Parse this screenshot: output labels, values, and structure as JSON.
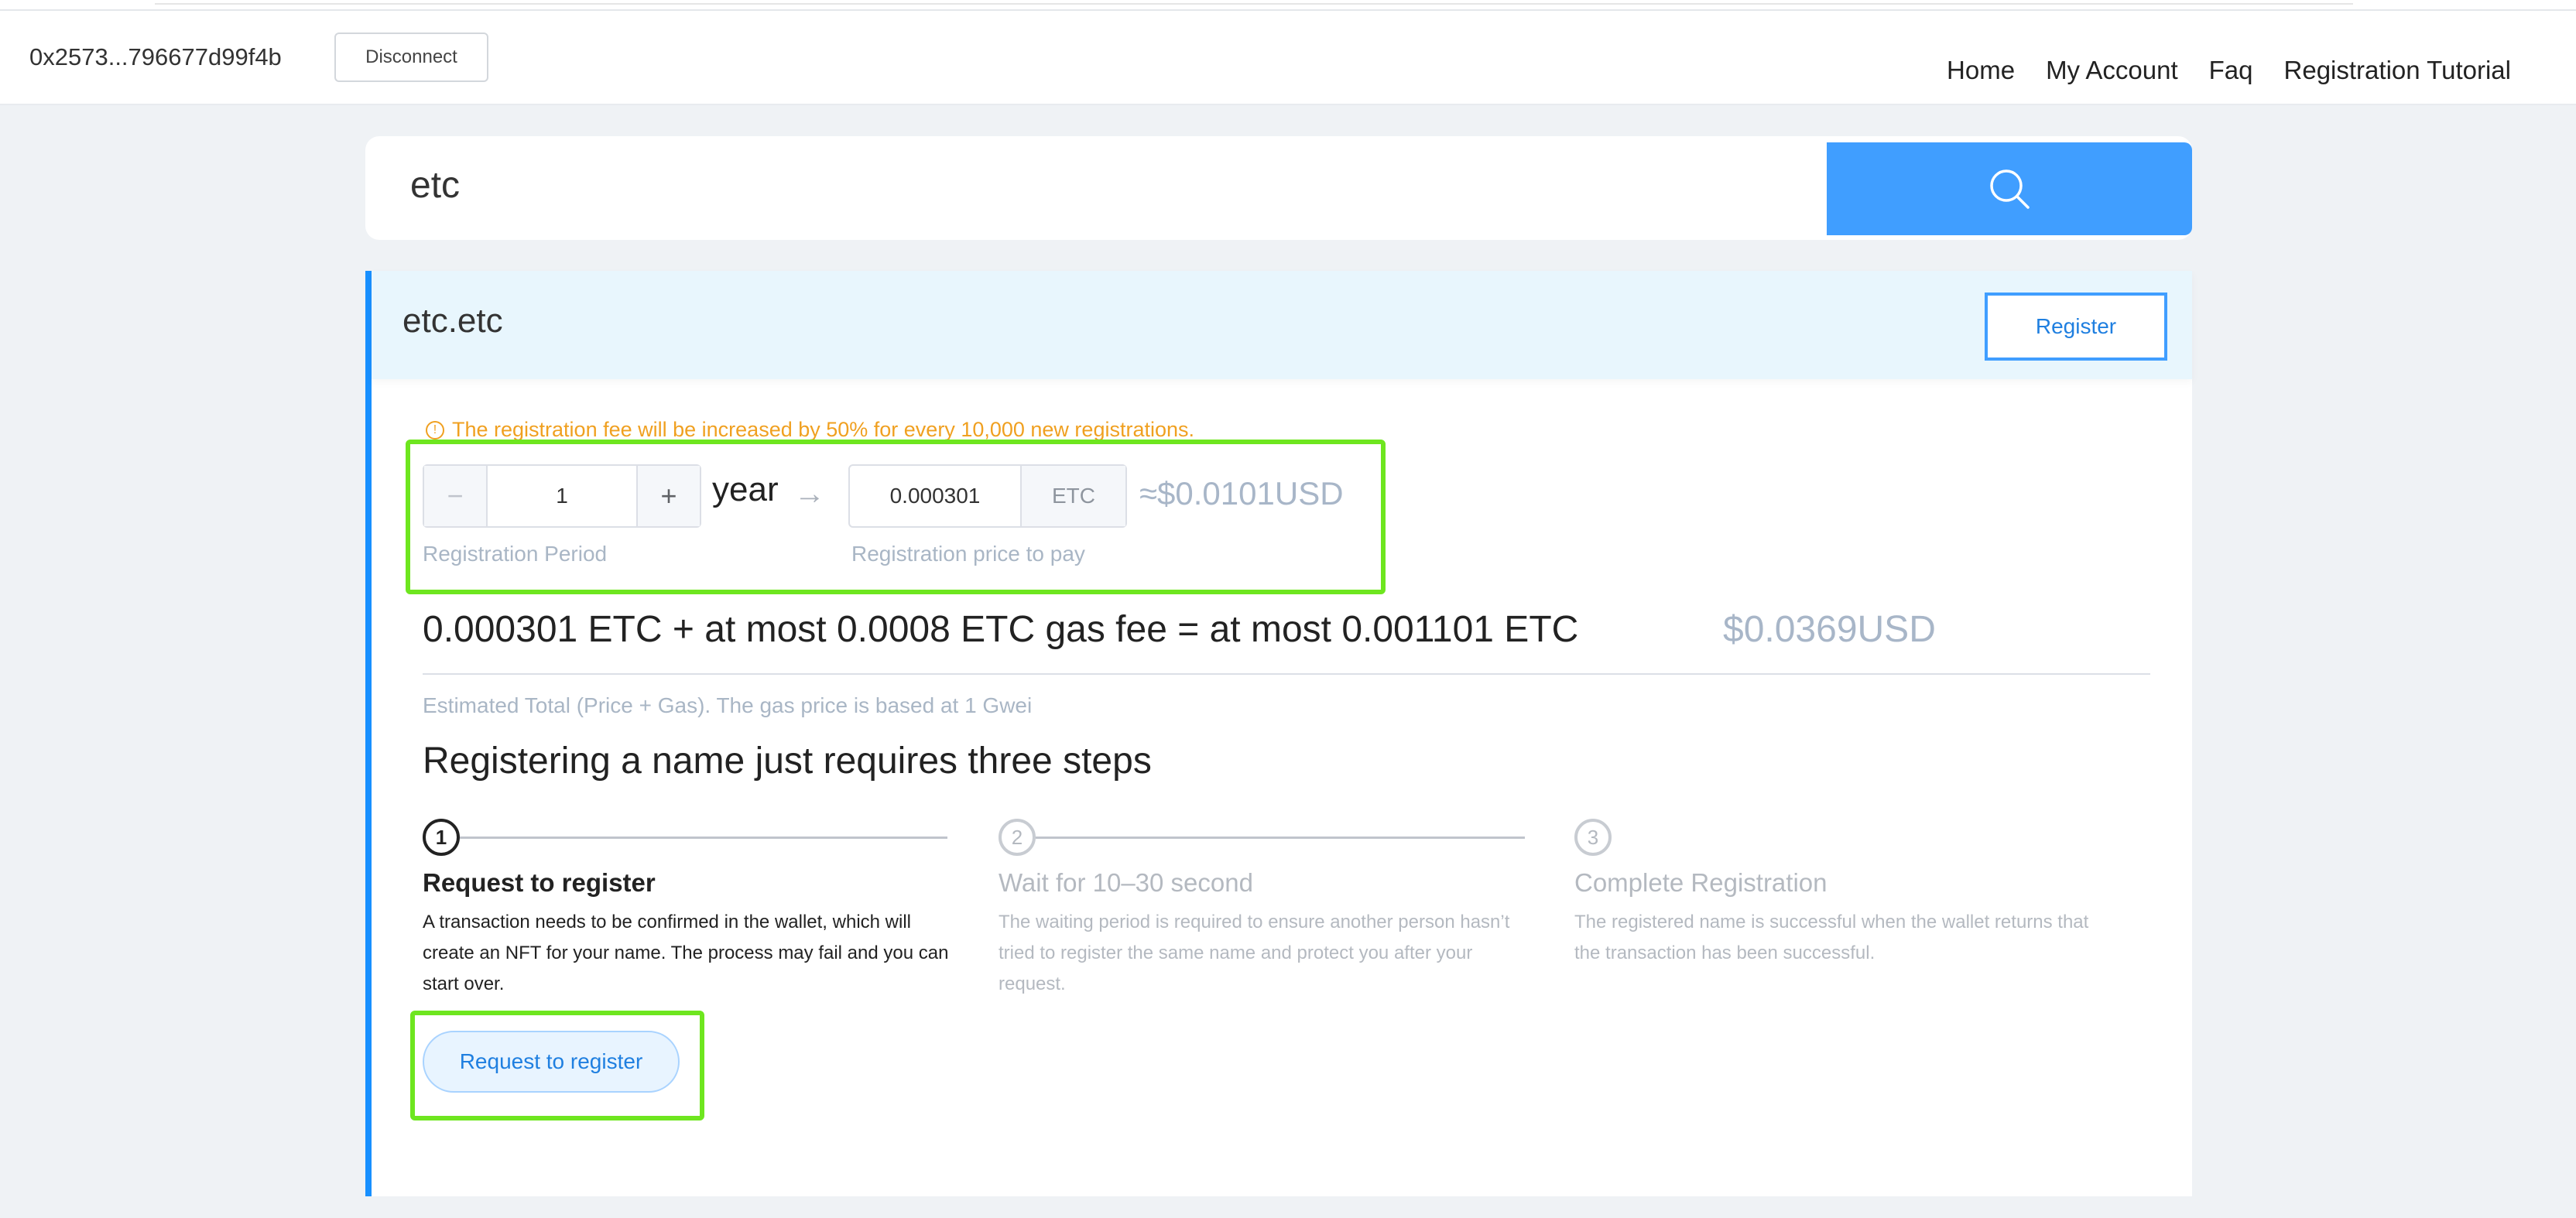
{
  "header": {
    "address": "0x2573...796677d99f4b",
    "disconnect_label": "Disconnect",
    "nav": [
      "Home",
      "My Account",
      "Faq",
      "Registration Tutorial"
    ]
  },
  "search": {
    "value": "etc",
    "icon": "search-icon",
    "button_color": "#409eff"
  },
  "result": {
    "domain": "etc.etc",
    "register_label": "Register",
    "accent_color": "#1890ff",
    "warning": "The registration fee will be increased by 50% for every 10,000 new registrations.",
    "warning_icon": "info-circle-icon",
    "period": {
      "value": "1",
      "minus": "−",
      "plus": "+",
      "unit": "year",
      "label": "Registration Period"
    },
    "arrow": "→",
    "price": {
      "value": "0.000301",
      "unit": "ETC",
      "usd": "≈$0.0101USD",
      "label": "Registration price to pay"
    },
    "total": {
      "text": "0.000301 ETC + at most 0.0008 ETC gas fee = at most 0.001101 ETC",
      "usd": "$0.0369USD",
      "note": "Estimated Total (Price + Gas). The gas price is based at 1 Gwei"
    },
    "steps_title": "Registering a name just requires three steps",
    "steps": [
      {
        "number": "1",
        "title": "Request to register",
        "desc": "A transaction needs to be confirmed in the wallet, which will create an NFT for your name. The process may fail and you can start over."
      },
      {
        "number": "2",
        "title": "Wait for 10–30 second",
        "desc": "The waiting period is required to ensure another person hasn’t tried to register the same name and protect you after your request."
      },
      {
        "number": "3",
        "title": "Complete Registration",
        "desc": "The registered name is successful when the wallet returns that the transaction has been successful."
      }
    ],
    "request_button_label": "Request to register"
  }
}
